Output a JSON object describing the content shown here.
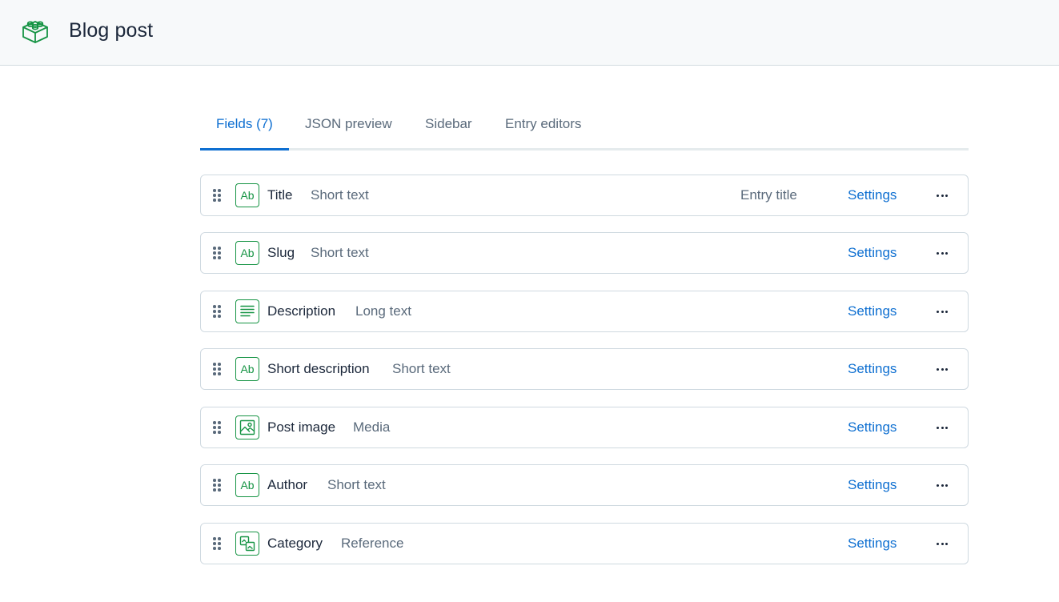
{
  "header": {
    "title": "Blog post",
    "icon": "content-type-icon"
  },
  "tabs": [
    {
      "label": "Fields (7)",
      "active": true
    },
    {
      "label": "JSON preview",
      "active": false
    },
    {
      "label": "Sidebar",
      "active": false
    },
    {
      "label": "Entry editors",
      "active": false
    }
  ],
  "fields": [
    {
      "name": "Title",
      "type": "Short text",
      "icon": "short-text-icon",
      "badge": "Entry title",
      "settings": "Settings"
    },
    {
      "name": "Slug",
      "type": "Short text",
      "icon": "short-text-icon",
      "settings": "Settings"
    },
    {
      "name": "Description",
      "type": "Long text",
      "icon": "long-text-icon",
      "settings": "Settings"
    },
    {
      "name": "Short description",
      "type": "Short text",
      "icon": "short-text-icon",
      "settings": "Settings"
    },
    {
      "name": "Post image",
      "type": "Media",
      "icon": "media-icon",
      "settings": "Settings"
    },
    {
      "name": "Author",
      "type": "Short text",
      "icon": "short-text-icon",
      "settings": "Settings"
    },
    {
      "name": "Category",
      "type": "Reference",
      "icon": "reference-icon",
      "settings": "Settings"
    }
  ],
  "colors": {
    "accent": "#0e6fd1",
    "field_icon": "#169444",
    "text": "#1b273a",
    "muted": "#5a6a7b"
  }
}
